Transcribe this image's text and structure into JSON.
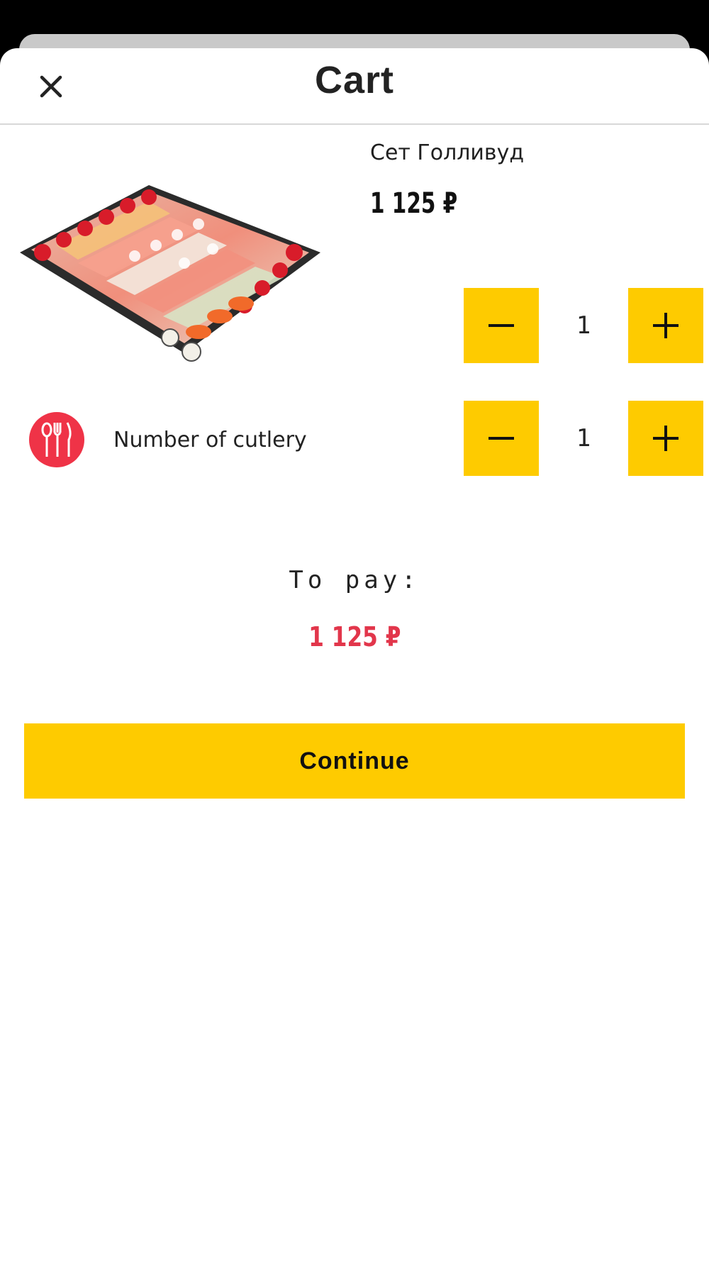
{
  "header": {
    "title": "Cart"
  },
  "product": {
    "name": "Сет Голливуд",
    "price": "1 125 ₽",
    "quantity": "1"
  },
  "cutlery": {
    "label": "Number of cutlery",
    "quantity": "1"
  },
  "summary": {
    "label": "To pay:",
    "total": "1 125 ₽"
  },
  "actions": {
    "continue_label": "Continue"
  },
  "colors": {
    "accent": "#fecb00",
    "price_highlight": "#e2364b",
    "cutlery_badge": "#ef3347"
  }
}
